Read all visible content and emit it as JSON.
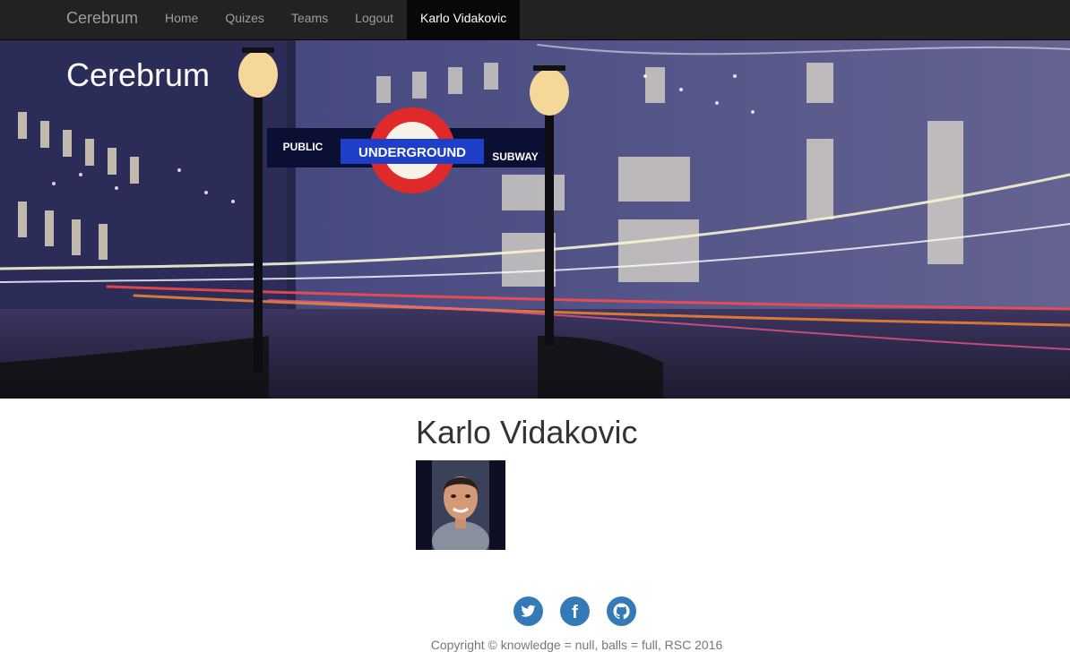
{
  "navbar": {
    "brand": "Cerebrum",
    "items": [
      {
        "label": "Home"
      },
      {
        "label": "Quizes"
      },
      {
        "label": "Teams"
      },
      {
        "label": "Logout"
      },
      {
        "label": "Karlo Vidakovic",
        "active": true
      }
    ]
  },
  "hero": {
    "title": "Cerebrum",
    "sign": {
      "left_text": "PUBLIC",
      "center_text": "UNDERGROUND",
      "right_text": "SUBWAY"
    }
  },
  "profile": {
    "name": "Karlo Vidakovic"
  },
  "footer": {
    "social": [
      {
        "icon": "twitter-icon"
      },
      {
        "icon": "facebook-icon",
        "glyph": "f"
      },
      {
        "icon": "github-icon"
      }
    ],
    "copyright": "Copyright © knowledge = null, balls = full, RSC 2016"
  },
  "colors": {
    "navbar_bg": "#222222",
    "nav_text": "#9d9d9d",
    "active_bg": "#080808",
    "social_blue": "#337ab7",
    "footer_text": "#777777"
  }
}
